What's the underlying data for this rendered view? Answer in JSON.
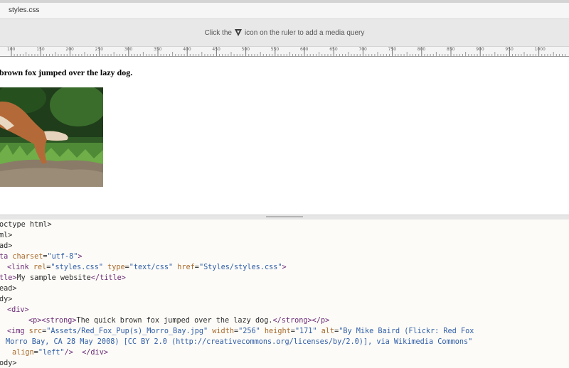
{
  "tab": {
    "filename": "styles.css"
  },
  "media_query_bar": {
    "text_before": "Click the",
    "icon": "media-query-triangle-icon",
    "text_after": "icon on the ruler to add a media query"
  },
  "ruler": {
    "labels": [
      "100",
      "150",
      "200",
      "250",
      "300",
      "350",
      "400",
      "450",
      "500",
      "550",
      "600",
      "650",
      "700",
      "750",
      "800",
      "850",
      "900",
      "950",
      "1000"
    ]
  },
  "live_view": {
    "heading": "brown fox jumped over the lazy dog.",
    "image_alt": "red-fox-photo"
  },
  "code": {
    "l1": {
      "text": "octype html>"
    },
    "l2": {
      "text": "ml>"
    },
    "l3": {
      "text": "ad>"
    },
    "l4": {
      "tag": "ta ",
      "attr1": "charset",
      "eq1": "=",
      "val1": "\"utf-8\"",
      "end": ">"
    },
    "l5": {
      "tag": "<link ",
      "attr1": "rel",
      "eq1": "=",
      "val1": "\"styles.css\"",
      "attr2": " type",
      "eq2": "=",
      "val2": "\"text/css\"",
      "attr3": " href",
      "eq3": "=",
      "val3": "\"Styles/styles.css\"",
      "end": ">"
    },
    "l6": {
      "tag": "tle>",
      "text": "My sample website",
      "end": "</title>"
    },
    "l7": {
      "text": "ead>"
    },
    "l8": {
      "text": "dy>"
    },
    "l9": {
      "text": "<div>"
    },
    "l10": {
      "tag": "<p><strong>",
      "text": "The quick brown fox jumped over the lazy dog.",
      "end": "</strong></p>"
    },
    "l11": {
      "tag": "<img ",
      "attr1": "src",
      "eq1": "=",
      "val1": "\"Assets/Red_Fox_Pup(s)_Morro_Bay.jpg\"",
      "attr2": " width",
      "eq2": "=",
      "val2": "\"256\"",
      "attr3": " height",
      "eq3": "=",
      "val3": "\"171\"",
      "attr4": " alt",
      "eq4": "=",
      "val4": "\"By Mike Baird (Flickr: Red Fox"
    },
    "l12": {
      "val": "Morro Bay, CA 28 May 2008) [CC BY 2.0 (http://creativecommons.org/licenses/by/2.0)], via Wikimedia Commons\""
    },
    "l13": {
      "attr": "align",
      "eq": "=",
      "val": "\"left\"",
      "end": "/>  </div>"
    },
    "l14": {
      "text": "ody>"
    }
  },
  "colors": {
    "tag": "#6a2a76",
    "attribute": "#a9692a",
    "value": "#2f5da8"
  }
}
